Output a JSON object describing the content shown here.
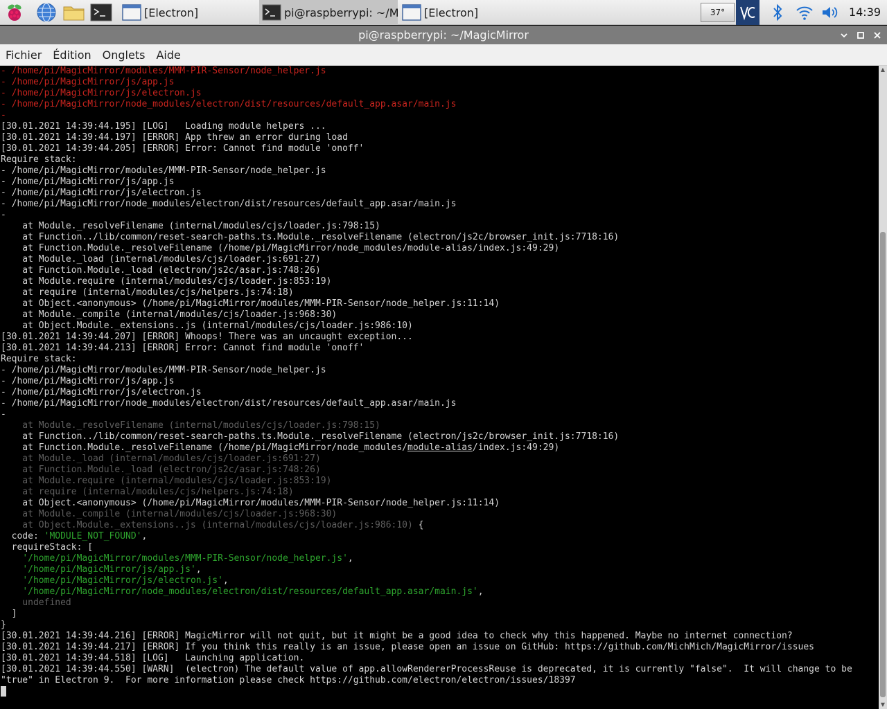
{
  "taskbar": {
    "tasks": [
      {
        "label": "[Electron]"
      },
      {
        "label": "pi@raspberrypi: ~/M..."
      },
      {
        "label": "[Electron]"
      }
    ],
    "temperature": "37°",
    "clock": "14:39"
  },
  "window": {
    "title": "pi@raspberrypi: ~/MagicMirror"
  },
  "menu": {
    "items": [
      "Fichier",
      "Édition",
      "Onglets",
      "Aide"
    ]
  },
  "terminal": {
    "lines": [
      [
        {
          "t": "- /home/pi/MagicMirror/modules/MMM-PIR-Sensor/node_helper.js",
          "c": "red"
        }
      ],
      [
        {
          "t": "- /home/pi/MagicMirror/js/app.js",
          "c": "red"
        }
      ],
      [
        {
          "t": "- /home/pi/MagicMirror/js/electron.js",
          "c": "red"
        }
      ],
      [
        {
          "t": "- /home/pi/MagicMirror/node_modules/electron/dist/resources/default_app.asar/main.js",
          "c": "red"
        }
      ],
      [
        {
          "t": "-",
          "c": "red"
        }
      ],
      [
        {
          "t": "[30.01.2021 14:39:44.195] [LOG]   Loading module helpers ..."
        }
      ],
      [
        {
          "t": "[30.01.2021 14:39:44.197] [ERROR] App threw an error during load"
        }
      ],
      [
        {
          "t": "[30.01.2021 14:39:44.205] [ERROR] Error: Cannot find module 'onoff'"
        }
      ],
      [
        {
          "t": "Require stack:"
        }
      ],
      [
        {
          "t": "- /home/pi/MagicMirror/modules/MMM-PIR-Sensor/node_helper.js"
        }
      ],
      [
        {
          "t": "- /home/pi/MagicMirror/js/app.js"
        }
      ],
      [
        {
          "t": "- /home/pi/MagicMirror/js/electron.js"
        }
      ],
      [
        {
          "t": "- /home/pi/MagicMirror/node_modules/electron/dist/resources/default_app.asar/main.js"
        }
      ],
      [
        {
          "t": "-"
        }
      ],
      [
        {
          "t": "    at Module._resolveFilename (internal/modules/cjs/loader.js:798:15)"
        }
      ],
      [
        {
          "t": "    at Function../lib/common/reset-search-paths.ts.Module._resolveFilename (electron/js2c/browser_init.js:7718:16)"
        }
      ],
      [
        {
          "t": "    at Function.Module._resolveFilename (/home/pi/MagicMirror/node_modules/module-alias/index.js:49:29)"
        }
      ],
      [
        {
          "t": "    at Module._load (internal/modules/cjs/loader.js:691:27)"
        }
      ],
      [
        {
          "t": "    at Function.Module._load (electron/js2c/asar.js:748:26)"
        }
      ],
      [
        {
          "t": "    at Module.require (internal/modules/cjs/loader.js:853:19)"
        }
      ],
      [
        {
          "t": "    at require (internal/modules/cjs/helpers.js:74:18)"
        }
      ],
      [
        {
          "t": "    at Object.<anonymous> (/home/pi/MagicMirror/modules/MMM-PIR-Sensor/node_helper.js:11:14)"
        }
      ],
      [
        {
          "t": "    at Module._compile (internal/modules/cjs/loader.js:968:30)"
        }
      ],
      [
        {
          "t": "    at Object.Module._extensions..js (internal/modules/cjs/loader.js:986:10)"
        }
      ],
      [
        {
          "t": "[30.01.2021 14:39:44.207] [ERROR] Whoops! There was an uncaught exception..."
        }
      ],
      [
        {
          "t": "[30.01.2021 14:39:44.213] [ERROR] Error: Cannot find module 'onoff'"
        }
      ],
      [
        {
          "t": "Require stack:"
        }
      ],
      [
        {
          "t": "- /home/pi/MagicMirror/modules/MMM-PIR-Sensor/node_helper.js"
        }
      ],
      [
        {
          "t": "- /home/pi/MagicMirror/js/app.js"
        }
      ],
      [
        {
          "t": "- /home/pi/MagicMirror/js/electron.js"
        }
      ],
      [
        {
          "t": "- /home/pi/MagicMirror/node_modules/electron/dist/resources/default_app.asar/main.js"
        }
      ],
      [
        {
          "t": "-"
        }
      ],
      [
        {
          "t": "    at Module._resolveFilename (internal/modules/cjs/loader.js:798:15)",
          "c": "grey"
        }
      ],
      [
        {
          "t": "    at Function../lib/common/reset-search-paths.ts.Module._resolveFilename (electron/js2c/browser_init.js:7718:16)"
        }
      ],
      [
        {
          "t": "    at Function.Module._resolveFilename (/home/pi/MagicMirror/node_modules/"
        },
        {
          "t": "module-alias",
          "c": "ul"
        },
        {
          "t": "/index.js:49:29)"
        }
      ],
      [
        {
          "t": "    at Module._load (internal/modules/cjs/loader.js:691:27)",
          "c": "grey"
        }
      ],
      [
        {
          "t": "    at Function.Module._load (electron/js2c/asar.js:748:26)",
          "c": "grey"
        }
      ],
      [
        {
          "t": "    at Module.require (internal/modules/cjs/loader.js:853:19)",
          "c": "grey"
        }
      ],
      [
        {
          "t": "    at require (internal/modules/cjs/helpers.js:74:18)",
          "c": "grey"
        }
      ],
      [
        {
          "t": "    at Object.<anonymous> (/home/pi/MagicMirror/modules/MMM-PIR-Sensor/node_helper.js:11:14)"
        }
      ],
      [
        {
          "t": "    at Module._compile (internal/modules/cjs/loader.js:968:30)",
          "c": "grey"
        }
      ],
      [
        {
          "t": "    at Object.Module._extensions..js (internal/modules/cjs/loader.js:986:10)",
          "c": "grey"
        },
        {
          "t": " {"
        }
      ],
      [
        {
          "t": "  code: "
        },
        {
          "t": "'MODULE_NOT_FOUND'",
          "c": "green"
        },
        {
          "t": ","
        }
      ],
      [
        {
          "t": "  requireStack: ["
        }
      ],
      [
        {
          "t": "    "
        },
        {
          "t": "'/home/pi/MagicMirror/modules/MMM-PIR-Sensor/node_helper.js'",
          "c": "green"
        },
        {
          "t": ","
        }
      ],
      [
        {
          "t": "    "
        },
        {
          "t": "'/home/pi/MagicMirror/js/app.js'",
          "c": "green"
        },
        {
          "t": ","
        }
      ],
      [
        {
          "t": "    "
        },
        {
          "t": "'/home/pi/MagicMirror/js/electron.js'",
          "c": "green"
        },
        {
          "t": ","
        }
      ],
      [
        {
          "t": "    "
        },
        {
          "t": "'/home/pi/MagicMirror/node_modules/electron/dist/resources/default_app.asar/main.js'",
          "c": "green"
        },
        {
          "t": ","
        }
      ],
      [
        {
          "t": "    undefined",
          "c": "grey"
        }
      ],
      [
        {
          "t": "  ]"
        }
      ],
      [
        {
          "t": "}"
        }
      ],
      [
        {
          "t": "[30.01.2021 14:39:44.216] [ERROR] MagicMirror will not quit, but it might be a good idea to check why this happened. Maybe no internet connection?"
        }
      ],
      [
        {
          "t": "[30.01.2021 14:39:44.217] [ERROR] If you think this really is an issue, please open an issue on GitHub: https://github.com/MichMich/MagicMirror/issues"
        }
      ],
      [
        {
          "t": "[30.01.2021 14:39:44.518] [LOG]   Launching application."
        }
      ],
      [
        {
          "t": "[30.01.2021 14:39:44.550] [WARN]  (electron) The default value of app.allowRendererProcessReuse is deprecated, it is currently \"false\".  It will change to be"
        }
      ],
      [
        {
          "t": "\"true\" in Electron 9.  For more information please check https://github.com/electron/electron/issues/18397"
        }
      ]
    ]
  }
}
